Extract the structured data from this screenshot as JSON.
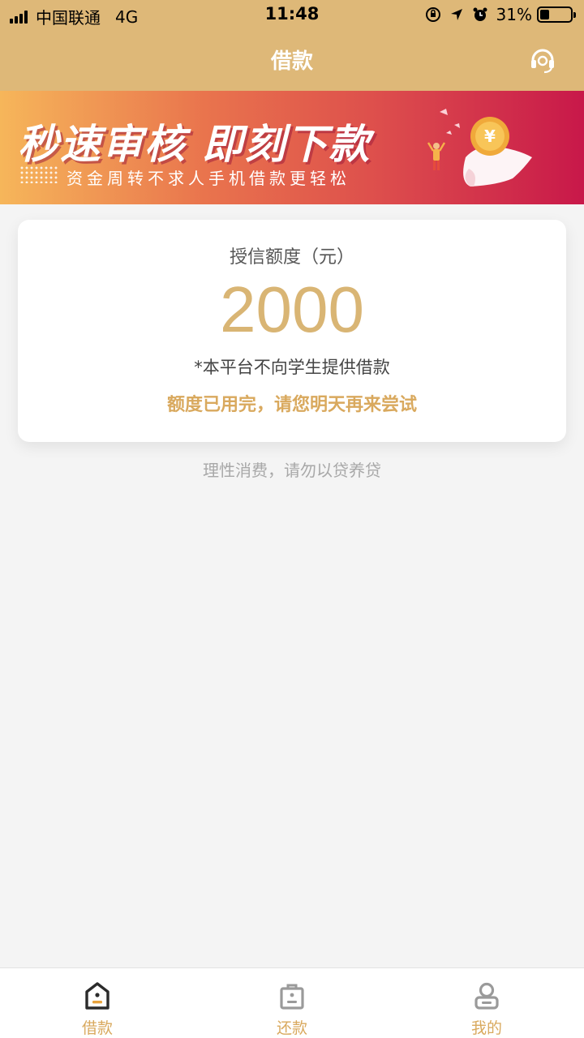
{
  "status_bar": {
    "carrier": "中国联通",
    "network": "4G",
    "time": "11:48",
    "battery_percent": "31%",
    "battery_level": 0.31,
    "icons": [
      "signal-icon",
      "orientation-lock-icon",
      "location-arrow-icon",
      "alarm-icon",
      "battery-icon"
    ]
  },
  "nav": {
    "title": "借款",
    "right_icon": "headset-support-icon"
  },
  "banner": {
    "headline": "秒速审核  即刻下款",
    "subline": "资金周转不求人手机借款更轻松",
    "art_icon": "yen-coin-icon"
  },
  "credit": {
    "label": "授信额度（元）",
    "amount": "2000",
    "note": "*本平台不向学生提供借款",
    "status": "额度已用完，请您明天再来尝试"
  },
  "tip": "理性消费，请勿以贷养贷",
  "tabs": [
    {
      "label": "借款",
      "icon": "house-icon",
      "active": true
    },
    {
      "label": "还款",
      "icon": "bag-icon",
      "active": false
    },
    {
      "label": "我的",
      "icon": "person-icon",
      "active": false
    }
  ],
  "colors": {
    "header_bg": "#deb878",
    "accent_gold": "#d9b574",
    "status_text": "#d9a95e",
    "page_bg": "#f4f4f4",
    "banner_start": "#f6b65a",
    "banner_end": "#c8184a"
  }
}
